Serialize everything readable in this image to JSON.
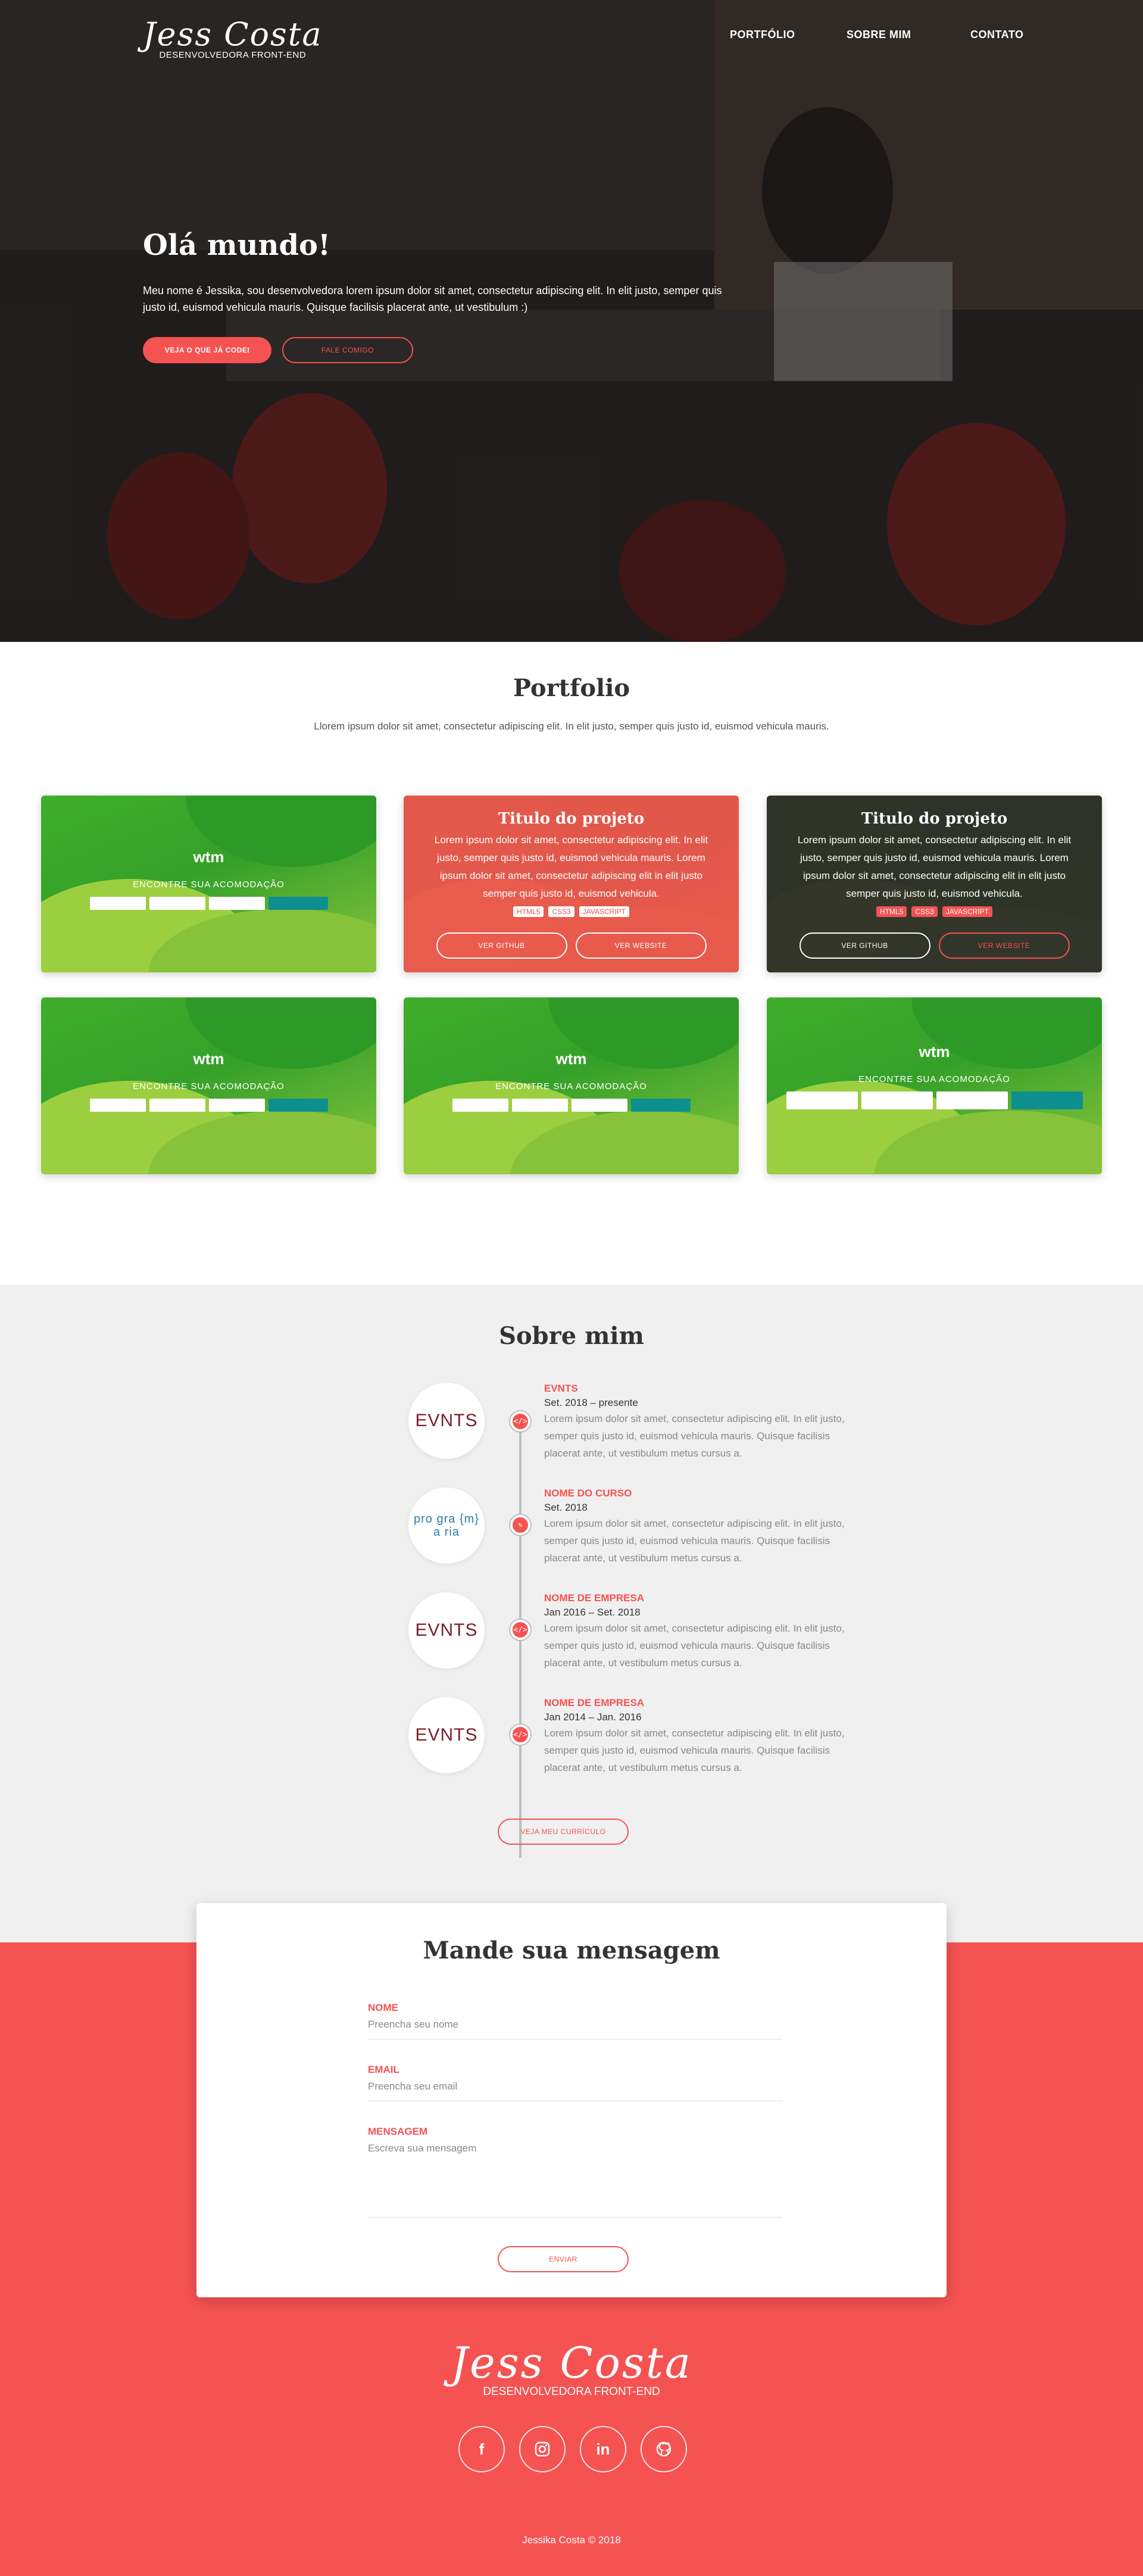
{
  "brand": {
    "name": "Jess Costa",
    "subtitle": "DESENVOLVEDORA FRONT-END"
  },
  "nav": {
    "items": [
      "PORTFÓLIO",
      "SOBRE MIM",
      "CONTATO"
    ]
  },
  "hero": {
    "title": "Olá mundo!",
    "text": "Meu nome é Jessika, sou desenvolvedora lorem ipsum dolor sit amet, consectetur adipiscing elit. In elit justo, semper quis justo id, euismod vehicula mauris. Quisque facilisis placerat ante, ut vestibulum :)",
    "primary_button": "VEJA O QUE JÁ CODEI",
    "secondary_button": "FALE COMIGO"
  },
  "portfolio": {
    "title": "Portfolio",
    "subtitle": "Llorem ipsum dolor sit amet, consectetur adipiscing elit. In elit justo, semper quis justo id, euismod vehicula mauris.",
    "project": {
      "title": "Titulo do projeto",
      "description": "Lorem ipsum dolor sit amet, consectetur adipiscing elit. In elit justo, semper quis justo id, euismod vehicula mauris. Lorem ipsum dolor sit amet, consectetur adipiscing elit in elit justo semper quis justo id, euismod vehicula.",
      "tags": [
        "HTML5",
        "CSS3",
        "JAVASCRIPT"
      ],
      "github_button": "VER GITHUB",
      "website_button": "VER WEBSITE"
    },
    "thumbnail": {
      "logo": "wtm",
      "tagline": "ENCONTRE SUA ACOMODAÇÃO"
    }
  },
  "about": {
    "title": "Sobre mim",
    "items": [
      {
        "logo": "EVNTS",
        "icon": "code-icon",
        "role": "EVNTS",
        "date": "Set. 2018 – presente",
        "desc": "Lorem ipsum dolor sit amet, consectetur adipiscing elit. In elit justo, semper quis justo id, euismod vehicula mauris. Quisque facilisis placerat ante, ut vestibulum metus cursus a."
      },
      {
        "logo": "pro gra {m} a ria",
        "icon": "pencil-icon",
        "role": "NOME DO CURSO",
        "date": "Set. 2018",
        "desc": "Lorem ipsum dolor sit amet, consectetur adipiscing elit. In elit justo, semper quis justo id, euismod vehicula mauris. Quisque facilisis placerat ante, ut vestibulum metus cursus a."
      },
      {
        "logo": "EVNTS",
        "icon": "code-icon",
        "role": "NOME DE EMPRESA",
        "date": "Jan 2016 – Set. 2018",
        "desc": "Lorem ipsum dolor sit amet, consectetur adipiscing elit. In elit justo, semper quis justo id, euismod vehicula mauris. Quisque facilisis placerat ante, ut vestibulum metus cursus a."
      },
      {
        "logo": "EVNTS",
        "icon": "code-icon",
        "role": "NOME DE EMPRESA",
        "date": "Jan 2014 – Jan. 2016",
        "desc": "Lorem ipsum dolor sit amet, consectetur adipiscing elit. In elit justo, semper quis justo id, euismod vehicula mauris. Quisque facilisis placerat ante, ut vestibulum metus cursus a."
      }
    ],
    "cv_button": "VEJA MEU CURRÍCULO"
  },
  "contact": {
    "title": "Mande sua mensagem",
    "name_label": "NOME",
    "name_placeholder": "Preencha seu nome",
    "email_label": "EMAIL",
    "email_placeholder": "Preencha seu email",
    "message_label": "MENSAGEM",
    "message_placeholder": "Escreva sua mensagem",
    "send_button": "ENVIAR"
  },
  "footer": {
    "brand": "Jess Costa",
    "subtitle": "DESENVOLVEDORA FRONT-END",
    "socials": [
      "facebook-icon",
      "instagram-icon",
      "linkedin-icon",
      "github-icon"
    ],
    "copyright": "Jessika Costa  ©  2018"
  },
  "colors": {
    "accent": "#f55252",
    "dark": "#333333",
    "light_bg": "#f0f0f0"
  }
}
